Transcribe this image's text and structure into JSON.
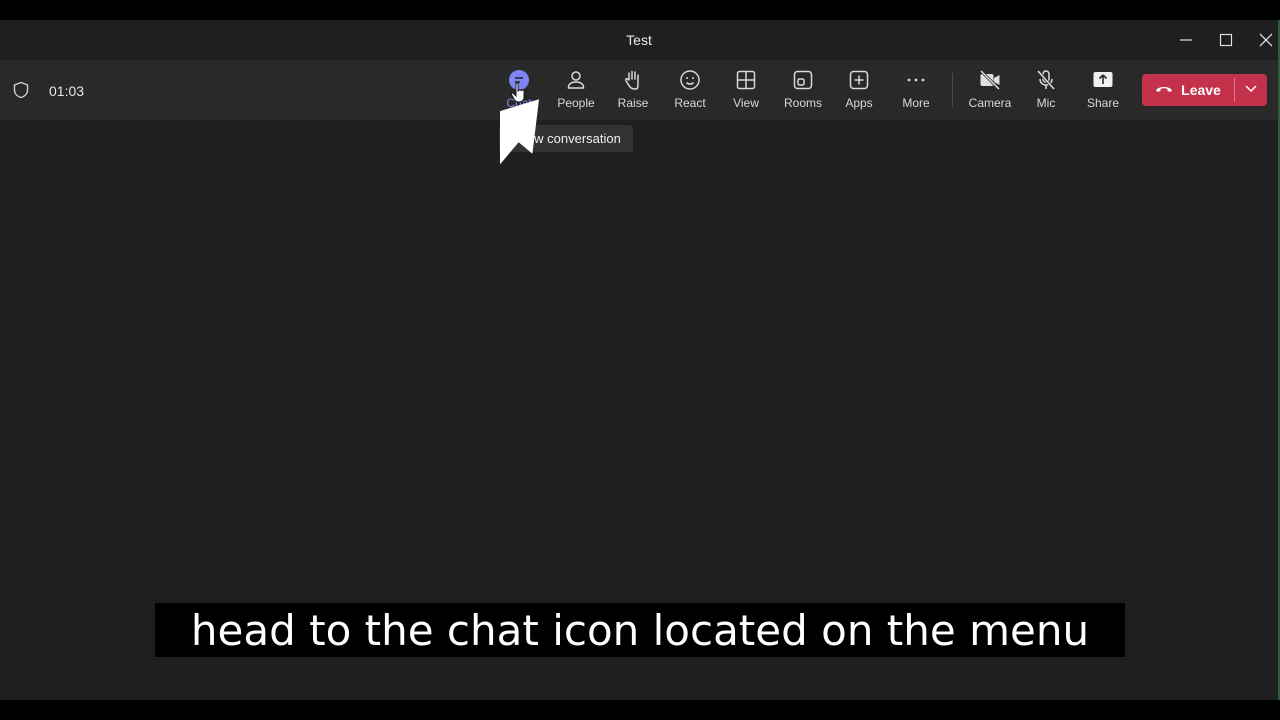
{
  "window": {
    "title": "Test",
    "controls": {
      "minimize": "minimize-icon",
      "maximize": "maximize-icon",
      "close": "close-icon"
    }
  },
  "toolbar": {
    "timer": "01:03",
    "buttons": [
      {
        "label": "Chat",
        "icon": "chat-icon",
        "active": true
      },
      {
        "label": "People",
        "icon": "person-icon"
      },
      {
        "label": "Raise",
        "icon": "hand-icon"
      },
      {
        "label": "React",
        "icon": "smiley-icon"
      },
      {
        "label": "View",
        "icon": "grid-icon"
      },
      {
        "label": "Rooms",
        "icon": "rooms-icon"
      },
      {
        "label": "Apps",
        "icon": "plus-icon"
      },
      {
        "label": "More",
        "icon": "ellipsis-icon"
      },
      {
        "label": "Camera",
        "icon": "camera-off-icon"
      },
      {
        "label": "Mic",
        "icon": "mic-off-icon"
      },
      {
        "label": "Share",
        "icon": "share-icon"
      }
    ],
    "leave_label": "Leave"
  },
  "tooltip": {
    "text": "Show conversation"
  },
  "caption": {
    "text": "head to the chat icon located on the menu"
  },
  "colors": {
    "accent": "#7f85f5",
    "leave": "#c4314b",
    "background": "#1f1f1f",
    "toolbar": "#292929"
  }
}
